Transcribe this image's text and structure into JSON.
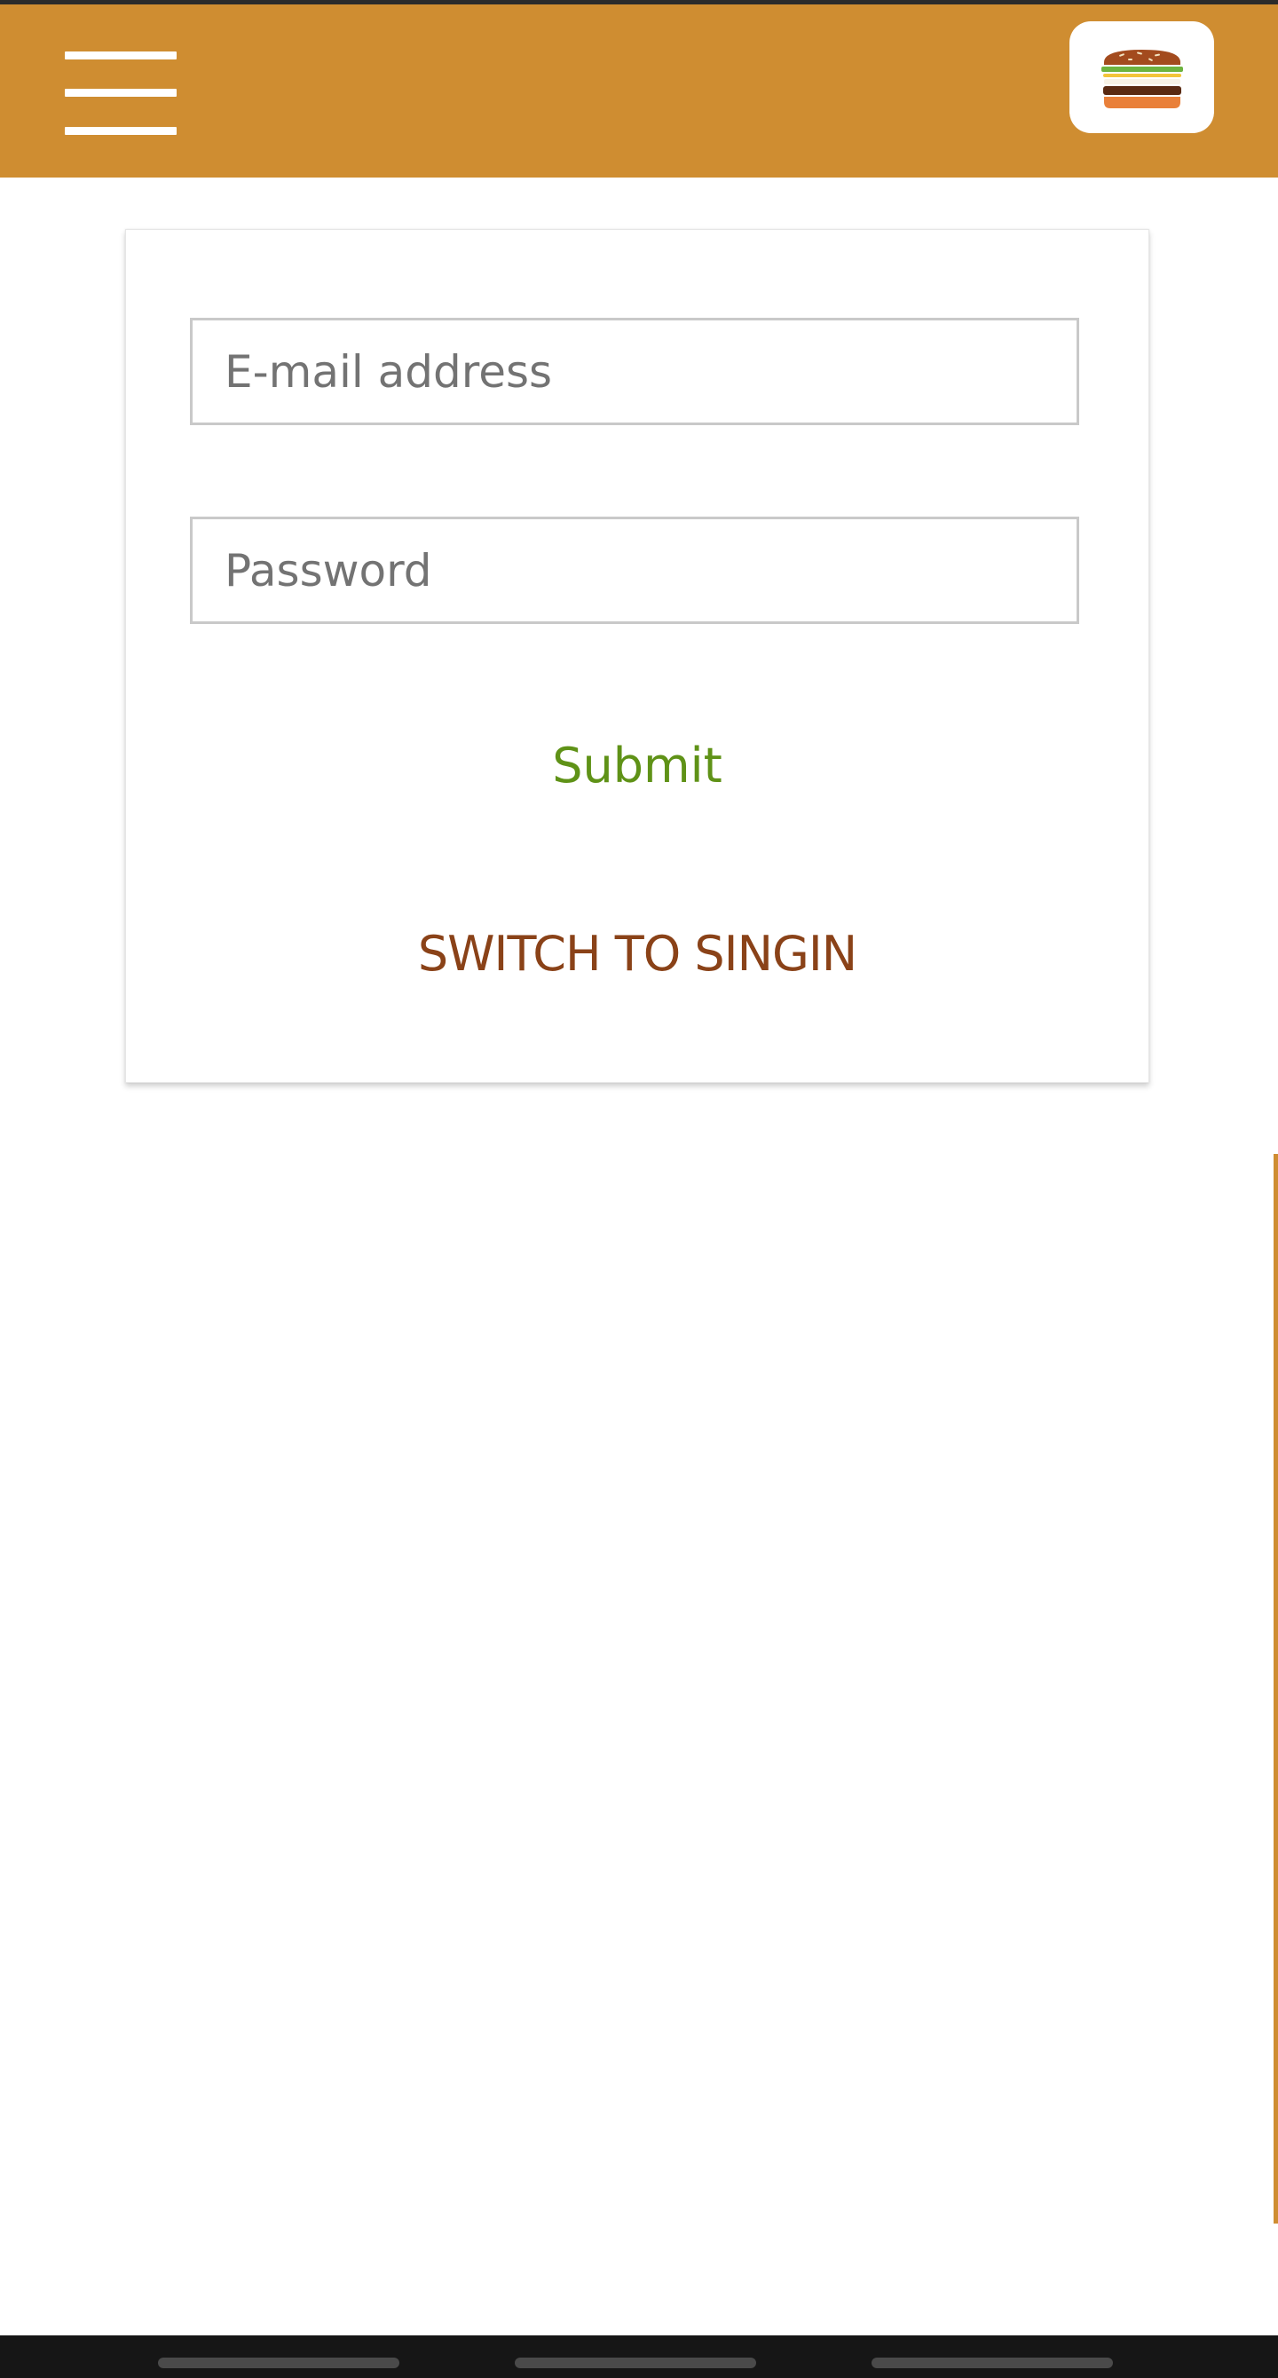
{
  "header": {
    "menu_icon": "hamburger-menu-icon",
    "logo_icon": "burger-logo-icon",
    "background_color": "#cf8d31"
  },
  "login_form": {
    "email": {
      "placeholder": "E-mail address",
      "value": ""
    },
    "password": {
      "placeholder": "Password",
      "value": ""
    },
    "submit_label": "Submit",
    "switch_label": "SWITCH TO SINGIN"
  },
  "colors": {
    "submit_text": "#5f9217",
    "switch_text": "#8a4218"
  }
}
